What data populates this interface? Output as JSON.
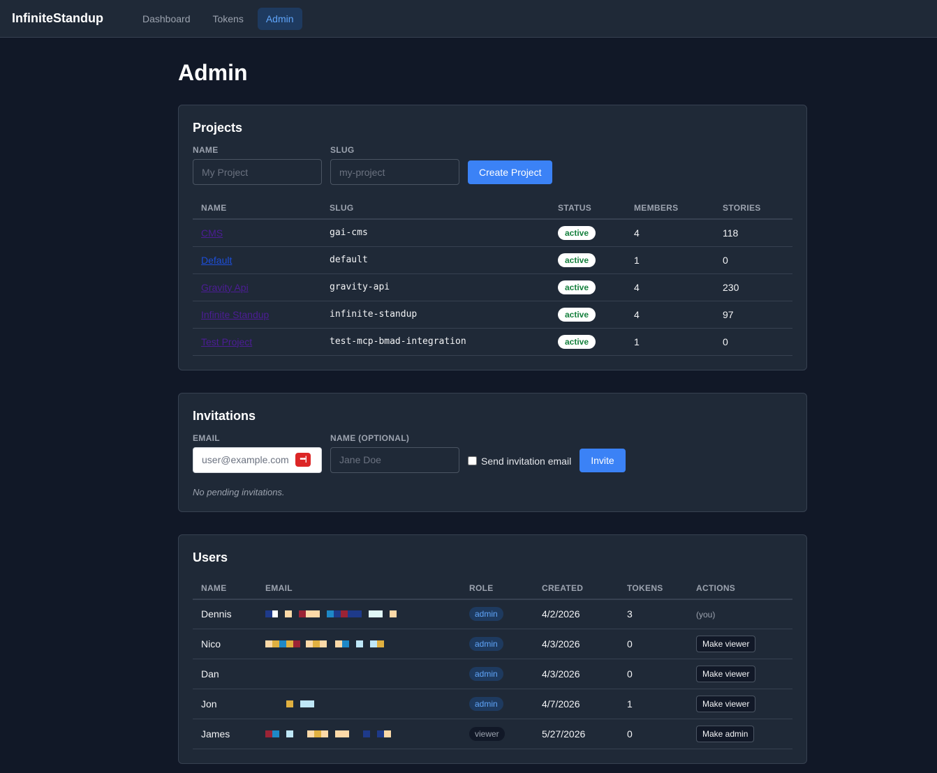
{
  "app": {
    "brand": "InfiniteStandup"
  },
  "nav": [
    {
      "label": "Dashboard"
    },
    {
      "label": "Tokens"
    },
    {
      "label": "Admin"
    }
  ],
  "page": {
    "title": "Admin"
  },
  "projects": {
    "title": "Projects",
    "name_label": "NAME",
    "name_placeholder": "My Project",
    "slug_label": "SLUG",
    "slug_placeholder": "my-project",
    "create_button": "Create Project",
    "columns": [
      "NAME",
      "SLUG",
      "STATUS",
      "MEMBERS",
      "STORIES"
    ],
    "rows": [
      {
        "name": "CMS",
        "slug": "gai-cms",
        "status": "active",
        "members": "4",
        "stories": "118"
      },
      {
        "name": "Default",
        "slug": "default",
        "status": "active",
        "members": "1",
        "stories": "0"
      },
      {
        "name": "Gravity Api",
        "slug": "gravity-api",
        "status": "active",
        "members": "4",
        "stories": "230"
      },
      {
        "name": "Infinite Standup",
        "slug": "infinite-standup",
        "status": "active",
        "members": "4",
        "stories": "97"
      },
      {
        "name": "Test Project",
        "slug": "test-mcp-bmad-integration",
        "status": "active",
        "members": "1",
        "stories": "0"
      }
    ]
  },
  "invitations": {
    "title": "Invitations",
    "email_label": "EMAIL",
    "email_placeholder": "user@example.com",
    "name_label": "NAME (OPTIONAL)",
    "name_placeholder": "Jane Doe",
    "send_email_label": "Send invitation email",
    "invite_button": "Invite",
    "empty_note": "No pending invitations."
  },
  "users": {
    "title": "Users",
    "columns": [
      "NAME",
      "EMAIL",
      "ROLE",
      "CREATED",
      "TOKENS",
      "ACTIONS"
    ],
    "rows": [
      {
        "name": "Dennis",
        "role": "admin",
        "created": "4/2/2026",
        "tokens": "3",
        "action": "(you)"
      },
      {
        "name": "Nico",
        "role": "admin",
        "created": "4/3/2026",
        "tokens": "0",
        "action": "Make viewer"
      },
      {
        "name": "Dan",
        "role": "admin",
        "created": "4/3/2026",
        "tokens": "0",
        "action": "Make viewer"
      },
      {
        "name": "Jon",
        "role": "admin",
        "created": "4/7/2026",
        "tokens": "1",
        "action": "Make viewer"
      },
      {
        "name": "James",
        "role": "viewer",
        "created": "5/27/2026",
        "tokens": "0",
        "action": "Make admin"
      }
    ]
  },
  "colors": {
    "background": "#111827",
    "card": "#1f2937",
    "accent": "#3b82f6",
    "status_active": "#15803d"
  }
}
